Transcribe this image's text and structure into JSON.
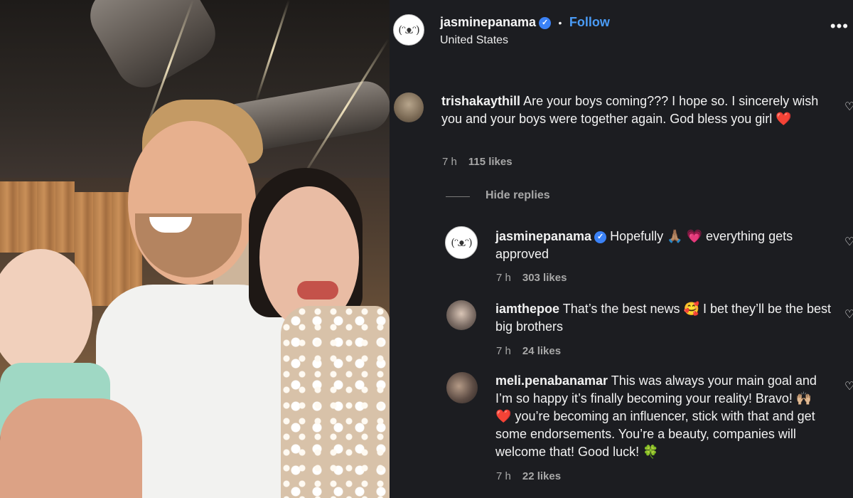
{
  "post": {
    "username": "jasminepanama",
    "follow_label": "Follow",
    "separator": "•",
    "location": "United States",
    "more_label": "•••",
    "avatar_text": "(ᵔᴥᵔ)"
  },
  "comments": [
    {
      "username": "trishakaythill",
      "text": "Are your boys coming??? I hope so. I sincerely wish you and your boys were together again. God bless you girl",
      "emoji": "❤️",
      "time": "7 h",
      "likes": "115 likes"
    }
  ],
  "hide_replies_label": "Hide replies",
  "replies": [
    {
      "username": "jasminepanama",
      "text_before": "Hopefully",
      "emoji_1": "🙏🏽",
      "emoji_2": "💗",
      "text_after": "everything gets approved",
      "time": "7 h",
      "likes": "303 likes"
    },
    {
      "username": "iamthepoe",
      "text_before": "That’s the best news",
      "emoji_1": "🥰",
      "text_after": "I bet they’ll be the best big brothers",
      "time": "7 h",
      "likes": "24 likes"
    },
    {
      "username": "meli.penabanamar",
      "text_before": "This was always your main goal and I’m so happy it’s finally becoming your reality! Bravo!",
      "emoji_1": "🙌🏼",
      "emoji_2": "❤️",
      "text_after": "you’re becoming an influencer, stick with that and get some endorsements. You’re a beauty, companies will welcome that! Good luck!",
      "emoji_3": "🍀",
      "time": "7 h",
      "likes": "22 likes"
    }
  ],
  "colors": {
    "panel_bg": "#1c1d21",
    "follow": "#4a9bf5",
    "verified": "#3b82f6",
    "meta_text": "#a8a8a8"
  }
}
